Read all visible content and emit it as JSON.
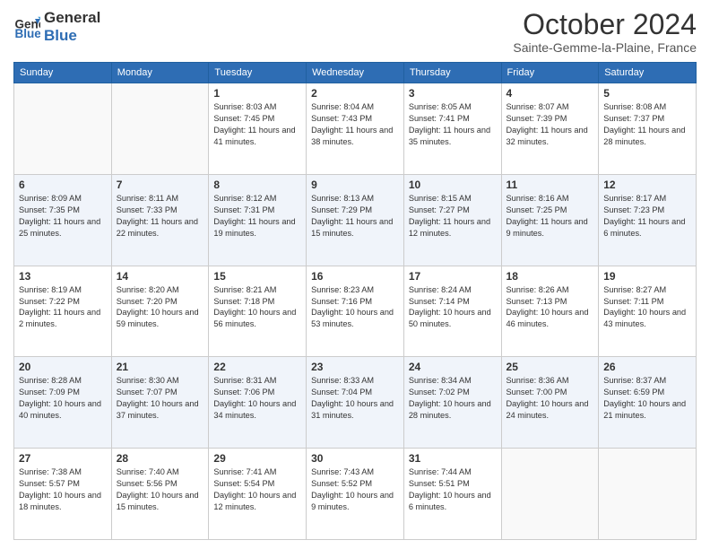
{
  "logo": {
    "line1": "General",
    "line2": "Blue"
  },
  "title": "October 2024",
  "subtitle": "Sainte-Gemme-la-Plaine, France",
  "days_of_week": [
    "Sunday",
    "Monday",
    "Tuesday",
    "Wednesday",
    "Thursday",
    "Friday",
    "Saturday"
  ],
  "weeks": [
    [
      {
        "day": "",
        "info": ""
      },
      {
        "day": "",
        "info": ""
      },
      {
        "day": "1",
        "info": "Sunrise: 8:03 AM\nSunset: 7:45 PM\nDaylight: 11 hours and 41 minutes."
      },
      {
        "day": "2",
        "info": "Sunrise: 8:04 AM\nSunset: 7:43 PM\nDaylight: 11 hours and 38 minutes."
      },
      {
        "day": "3",
        "info": "Sunrise: 8:05 AM\nSunset: 7:41 PM\nDaylight: 11 hours and 35 minutes."
      },
      {
        "day": "4",
        "info": "Sunrise: 8:07 AM\nSunset: 7:39 PM\nDaylight: 11 hours and 32 minutes."
      },
      {
        "day": "5",
        "info": "Sunrise: 8:08 AM\nSunset: 7:37 PM\nDaylight: 11 hours and 28 minutes."
      }
    ],
    [
      {
        "day": "6",
        "info": "Sunrise: 8:09 AM\nSunset: 7:35 PM\nDaylight: 11 hours and 25 minutes."
      },
      {
        "day": "7",
        "info": "Sunrise: 8:11 AM\nSunset: 7:33 PM\nDaylight: 11 hours and 22 minutes."
      },
      {
        "day": "8",
        "info": "Sunrise: 8:12 AM\nSunset: 7:31 PM\nDaylight: 11 hours and 19 minutes."
      },
      {
        "day": "9",
        "info": "Sunrise: 8:13 AM\nSunset: 7:29 PM\nDaylight: 11 hours and 15 minutes."
      },
      {
        "day": "10",
        "info": "Sunrise: 8:15 AM\nSunset: 7:27 PM\nDaylight: 11 hours and 12 minutes."
      },
      {
        "day": "11",
        "info": "Sunrise: 8:16 AM\nSunset: 7:25 PM\nDaylight: 11 hours and 9 minutes."
      },
      {
        "day": "12",
        "info": "Sunrise: 8:17 AM\nSunset: 7:23 PM\nDaylight: 11 hours and 6 minutes."
      }
    ],
    [
      {
        "day": "13",
        "info": "Sunrise: 8:19 AM\nSunset: 7:22 PM\nDaylight: 11 hours and 2 minutes."
      },
      {
        "day": "14",
        "info": "Sunrise: 8:20 AM\nSunset: 7:20 PM\nDaylight: 10 hours and 59 minutes."
      },
      {
        "day": "15",
        "info": "Sunrise: 8:21 AM\nSunset: 7:18 PM\nDaylight: 10 hours and 56 minutes."
      },
      {
        "day": "16",
        "info": "Sunrise: 8:23 AM\nSunset: 7:16 PM\nDaylight: 10 hours and 53 minutes."
      },
      {
        "day": "17",
        "info": "Sunrise: 8:24 AM\nSunset: 7:14 PM\nDaylight: 10 hours and 50 minutes."
      },
      {
        "day": "18",
        "info": "Sunrise: 8:26 AM\nSunset: 7:13 PM\nDaylight: 10 hours and 46 minutes."
      },
      {
        "day": "19",
        "info": "Sunrise: 8:27 AM\nSunset: 7:11 PM\nDaylight: 10 hours and 43 minutes."
      }
    ],
    [
      {
        "day": "20",
        "info": "Sunrise: 8:28 AM\nSunset: 7:09 PM\nDaylight: 10 hours and 40 minutes."
      },
      {
        "day": "21",
        "info": "Sunrise: 8:30 AM\nSunset: 7:07 PM\nDaylight: 10 hours and 37 minutes."
      },
      {
        "day": "22",
        "info": "Sunrise: 8:31 AM\nSunset: 7:06 PM\nDaylight: 10 hours and 34 minutes."
      },
      {
        "day": "23",
        "info": "Sunrise: 8:33 AM\nSunset: 7:04 PM\nDaylight: 10 hours and 31 minutes."
      },
      {
        "day": "24",
        "info": "Sunrise: 8:34 AM\nSunset: 7:02 PM\nDaylight: 10 hours and 28 minutes."
      },
      {
        "day": "25",
        "info": "Sunrise: 8:36 AM\nSunset: 7:00 PM\nDaylight: 10 hours and 24 minutes."
      },
      {
        "day": "26",
        "info": "Sunrise: 8:37 AM\nSunset: 6:59 PM\nDaylight: 10 hours and 21 minutes."
      }
    ],
    [
      {
        "day": "27",
        "info": "Sunrise: 7:38 AM\nSunset: 5:57 PM\nDaylight: 10 hours and 18 minutes."
      },
      {
        "day": "28",
        "info": "Sunrise: 7:40 AM\nSunset: 5:56 PM\nDaylight: 10 hours and 15 minutes."
      },
      {
        "day": "29",
        "info": "Sunrise: 7:41 AM\nSunset: 5:54 PM\nDaylight: 10 hours and 12 minutes."
      },
      {
        "day": "30",
        "info": "Sunrise: 7:43 AM\nSunset: 5:52 PM\nDaylight: 10 hours and 9 minutes."
      },
      {
        "day": "31",
        "info": "Sunrise: 7:44 AM\nSunset: 5:51 PM\nDaylight: 10 hours and 6 minutes."
      },
      {
        "day": "",
        "info": ""
      },
      {
        "day": "",
        "info": ""
      }
    ]
  ]
}
